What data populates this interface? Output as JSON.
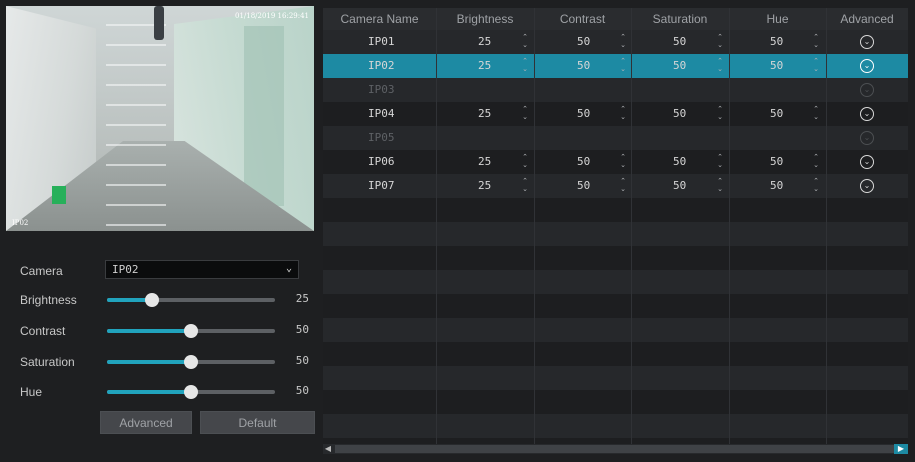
{
  "preview": {
    "timestamp": "01/18/2019 16:29:41",
    "camera_label": "IP02"
  },
  "controls": {
    "camera_label": "Camera",
    "camera_value": "IP02",
    "brightness_label": "Brightness",
    "brightness_value": "25",
    "brightness_fraction": 0.27,
    "contrast_label": "Contrast",
    "contrast_value": "50",
    "contrast_fraction": 0.5,
    "saturation_label": "Saturation",
    "saturation_value": "50",
    "saturation_fraction": 0.5,
    "hue_label": "Hue",
    "hue_value": "50",
    "hue_fraction": 0.5,
    "advanced_button": "Advanced",
    "default_button": "Default"
  },
  "table": {
    "headers": [
      "Camera Name",
      "Brightness",
      "Contrast",
      "Saturation",
      "Hue",
      "Advanced"
    ],
    "rows": [
      {
        "name": "IP01",
        "brightness": "25",
        "contrast": "50",
        "saturation": "50",
        "hue": "50",
        "enabled": true,
        "selected": false
      },
      {
        "name": "IP02",
        "brightness": "25",
        "contrast": "50",
        "saturation": "50",
        "hue": "50",
        "enabled": true,
        "selected": true
      },
      {
        "name": "IP03",
        "brightness": "",
        "contrast": "",
        "saturation": "",
        "hue": "",
        "enabled": false,
        "selected": false
      },
      {
        "name": "IP04",
        "brightness": "25",
        "contrast": "50",
        "saturation": "50",
        "hue": "50",
        "enabled": true,
        "selected": false
      },
      {
        "name": "IP05",
        "brightness": "",
        "contrast": "",
        "saturation": "",
        "hue": "",
        "enabled": false,
        "selected": false
      },
      {
        "name": "IP06",
        "brightness": "25",
        "contrast": "50",
        "saturation": "50",
        "hue": "50",
        "enabled": true,
        "selected": false
      },
      {
        "name": "IP07",
        "brightness": "25",
        "contrast": "50",
        "saturation": "50",
        "hue": "50",
        "enabled": true,
        "selected": false
      }
    ],
    "total_rows": 18
  },
  "colors": {
    "accent": "#1d8aa3",
    "slider_fill": "#21a3bd"
  }
}
